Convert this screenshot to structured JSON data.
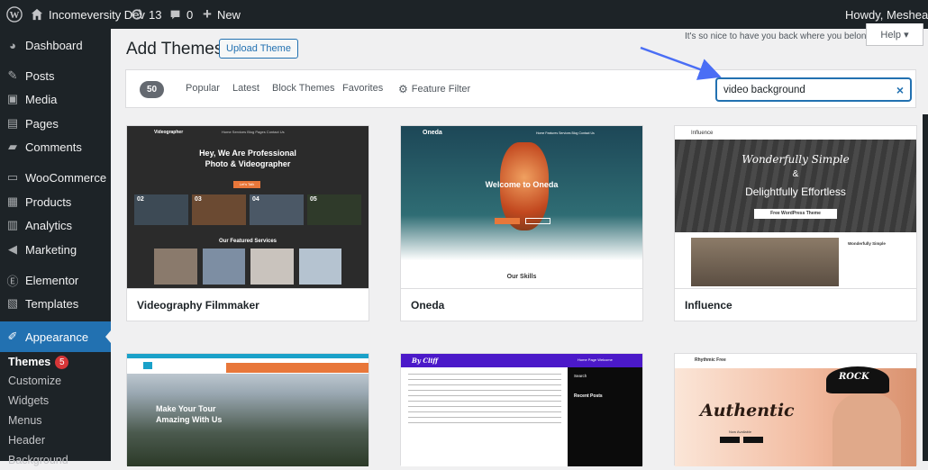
{
  "adminbar": {
    "site_name": "Incomeversity Dev",
    "updates": "13",
    "comments": "0",
    "new_label": "New",
    "howdy": "Howdy, Mesheal"
  },
  "sidebar": {
    "items": [
      {
        "label": "Dashboard",
        "icon": "dashboard-icon"
      },
      {
        "label": "Posts",
        "icon": "pin-icon"
      },
      {
        "label": "Media",
        "icon": "media-icon"
      },
      {
        "label": "Pages",
        "icon": "pages-icon"
      },
      {
        "label": "Comments",
        "icon": "comment-icon"
      },
      {
        "label": "WooCommerce",
        "icon": "woo-icon"
      },
      {
        "label": "Products",
        "icon": "products-icon"
      },
      {
        "label": "Analytics",
        "icon": "analytics-icon"
      },
      {
        "label": "Marketing",
        "icon": "marketing-icon"
      },
      {
        "label": "Elementor",
        "icon": "elementor-icon"
      },
      {
        "label": "Templates",
        "icon": "templates-icon"
      },
      {
        "label": "Appearance",
        "icon": "brush-icon"
      }
    ],
    "submenu": [
      "Themes",
      "Customize",
      "Widgets",
      "Menus",
      "Header",
      "Background"
    ],
    "themes_badge": "5"
  },
  "page": {
    "title": "Add Themes",
    "upload_label": "Upload Theme",
    "welcome": "It's so nice to have you back where you belong",
    "help": "Help ▾"
  },
  "filter": {
    "count": "50",
    "tabs": [
      "Popular",
      "Latest",
      "Block Themes",
      "Favorites",
      "Feature Filter"
    ],
    "search_value": "video background",
    "clear": "×"
  },
  "themes": [
    {
      "name": "Videography Filmmaker",
      "brand": "Videographer",
      "nav": "Home    Services    Blog    Pages    Contact Us",
      "headline1": "Hey, We Are Professional",
      "headline2": "Photo & Videographer",
      "nums": [
        "02",
        "03",
        "04",
        "05"
      ],
      "section": "Our Featured Services",
      "button": "Let's Talk"
    },
    {
      "name": "Oneda",
      "brand": "Oneda",
      "nav": "Home  Features  Services  Blog  Contact Us",
      "hero": "Welcome to Oneda",
      "section": "Our Skills"
    },
    {
      "name": "Influence",
      "brand": "Influence",
      "script": "Wonderfully Simple",
      "amp": "&",
      "hero": "Delightfully Effortless",
      "ribbon": "Free WordPress Theme",
      "side": "Wonderfully Simple"
    },
    {
      "name": "",
      "hero1": "Make Your Tour",
      "hero2": "Amazing With Us"
    },
    {
      "name": "",
      "brand": "By Cliff",
      "nav": "Home   Page   Welcome",
      "side1": "Search",
      "side2": "Recent Posts"
    },
    {
      "name": "",
      "brand": "Rhythmic Free",
      "hero": "Authentic",
      "sub": "Now Available",
      "cap": "ROCK"
    }
  ],
  "colors": {
    "accent": "#2271b1",
    "bar": "#1d2327",
    "badge": "#d63638"
  }
}
